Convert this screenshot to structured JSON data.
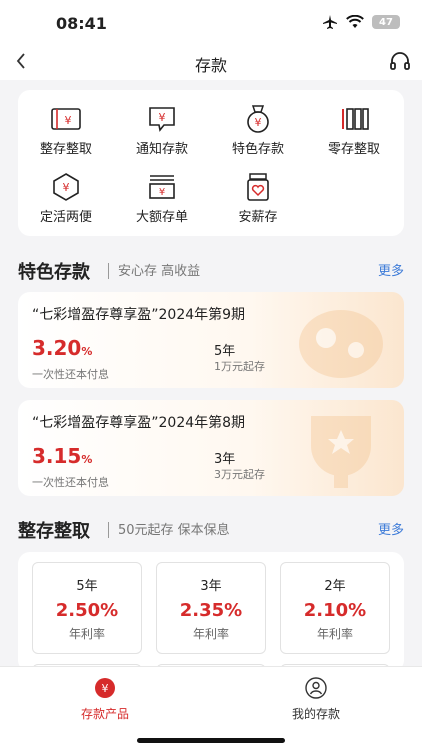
{
  "status_bar": {
    "time": "08:41",
    "battery": "47"
  },
  "nav": {
    "title": "存款"
  },
  "grid": [
    {
      "label": "整存整取",
      "icon": "passbook-yuan-icon"
    },
    {
      "label": "通知存款",
      "icon": "message-yuan-icon"
    },
    {
      "label": "特色存款",
      "icon": "medal-yuan-icon"
    },
    {
      "label": "零存整取",
      "icon": "bars-icon"
    },
    {
      "label": "定活两便",
      "icon": "hexagon-yuan-icon"
    },
    {
      "label": "大额存单",
      "icon": "stack-yuan-icon"
    },
    {
      "label": "安薪存",
      "icon": "heart-jar-icon"
    }
  ],
  "featured": {
    "title": "特色存款",
    "subtitle": "安心存 高收益",
    "more": "更多",
    "products": [
      {
        "title": "“七彩增盈存尊享盈”2024年第9期",
        "rate": "3.20",
        "rate_unit": "%",
        "rate_desc": "一次性还本付息",
        "term": "5年",
        "term_desc": "1万元起存"
      },
      {
        "title": "“七彩增盈存尊享盈”2024年第8期",
        "rate": "3.15",
        "rate_unit": "%",
        "rate_desc": "一次性还本付息",
        "term": "3年",
        "term_desc": "3万元起存"
      }
    ]
  },
  "fixed": {
    "title": "整存整取",
    "subtitle": "50元起存 保本保息",
    "more": "更多",
    "rates": [
      {
        "term": "5年",
        "rate": "2.50%",
        "label": "年利率"
      },
      {
        "term": "3年",
        "rate": "2.35%",
        "label": "年利率"
      },
      {
        "term": "2年",
        "rate": "2.10%",
        "label": "年利率"
      }
    ]
  },
  "tabbar": {
    "tabs": [
      {
        "label": "存款产品",
        "active": true
      },
      {
        "label": "我的存款",
        "active": false
      }
    ]
  },
  "colors": {
    "accent": "#d62b2b",
    "link": "#3d7bd8",
    "background": "#f4f4f6"
  }
}
